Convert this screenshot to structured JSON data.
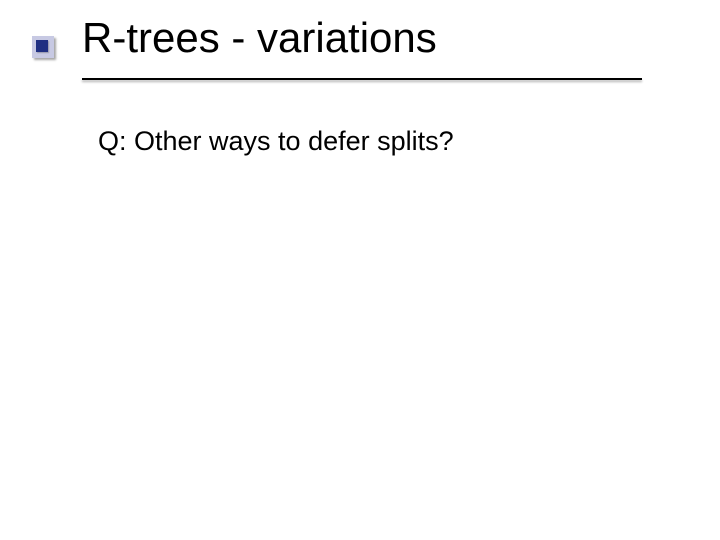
{
  "slide": {
    "title": "R-trees - variations",
    "body": "Q: Other ways to defer splits?"
  }
}
